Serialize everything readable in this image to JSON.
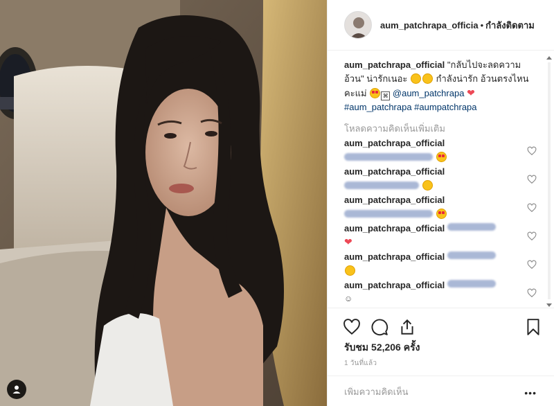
{
  "header": {
    "username": "aum_patchrapa_officia",
    "separator": "•",
    "follow_label": "กำลังติดตาม"
  },
  "caption": {
    "username": "aum_patchrapa_official",
    "text_1": "\"กลับไปจะลดความอ้วน\" น่ารักเนอะ",
    "text_2": "กำลังน่ารัก อ้วนตรงไหนคะแม่",
    "mention": "@aum_patchrapa",
    "hashtags": "#aum_patchrapa #aumpatchrapa"
  },
  "load_more_label": "โหลดความคิดเห็นเพิ่มเติม",
  "comments": [
    {
      "username": "aum_patchrapa_official",
      "emoji": "heart-eyes"
    },
    {
      "username": "aum_patchrapa_official",
      "emoji": "smile"
    },
    {
      "username": "aum_patchrapa_official",
      "emoji": "heart-eyes"
    },
    {
      "username": "aum_patchrapa_official",
      "emoji": "heart"
    },
    {
      "username": "aum_patchrapa_official",
      "emoji": "smile"
    },
    {
      "username": "aum_patchrapa_official",
      "emoji": "small-face"
    }
  ],
  "likes_text": "รับชม 52,206 ครั้ง",
  "timestamp": "1 วันที่แล้ว",
  "add_comment_placeholder": "เพิ่มความคิดเห็น",
  "more_label": "•••",
  "icons": {
    "like": "heart-outline-icon",
    "comment": "comment-bubble-icon",
    "share": "share-icon",
    "save": "bookmark-icon",
    "user_tag": "user-tag-icon"
  },
  "colors": {
    "link": "#003569",
    "muted": "#999999",
    "border": "#efefef",
    "heart": "#ed4956"
  }
}
